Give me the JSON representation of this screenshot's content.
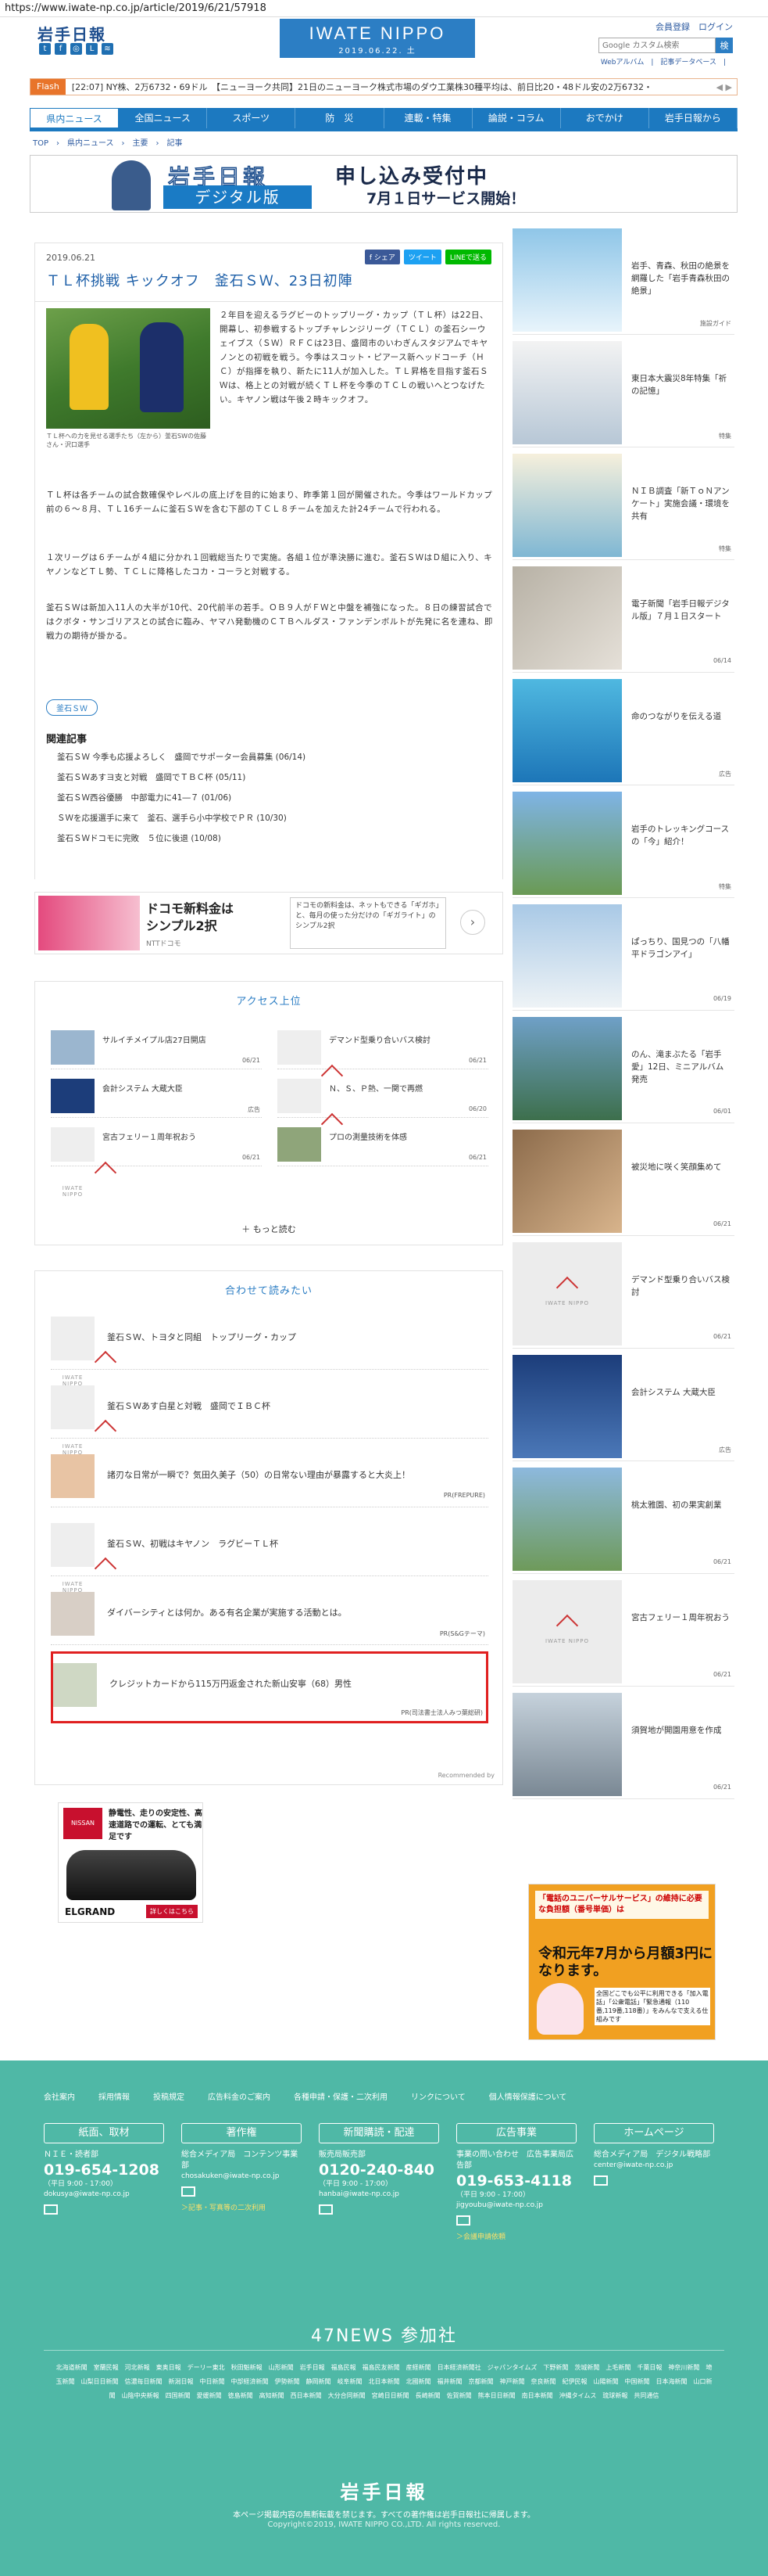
{
  "url": "https://www.iwate-np.co.jp/article/2019/6/21/57918",
  "header": {
    "logo": "岩手日報",
    "center_logo": "IWATE NIPPO",
    "center_date": "2019.06.22. 土",
    "member": "会員登録　ログイン",
    "search_placeholder": "Google カスタム検索",
    "search_button": "検",
    "toplinks": "Webアルバム　|　記事データベース　|　"
  },
  "flash": {
    "label": "Flash",
    "message": "[22:07] NY株、2万6732・69ドル　【ニューヨーク共同】21日のニューヨーク株式市場のダウ工業株30種平均は、前日比20・48ドル安の2万6732・",
    "arrows": "◀ ▶"
  },
  "nav": [
    "県内ニュース",
    "全国ニュース",
    "スポーツ",
    "防　災",
    "連載・特集",
    "論説・コラム",
    "おでかけ",
    "岩手日報から"
  ],
  "breadcrumb": "TOP　›　県内ニュース　›　主要　›　記事",
  "banner": {
    "logo": "岩手日報",
    "digital": "デジタル版",
    "title": "申し込み受付中",
    "subtitle": "7月１日サービス開始！"
  },
  "article": {
    "date": "2019.06.21",
    "share": [
      "f シェア",
      "ツイート",
      "LINEで送る"
    ],
    "title": "ＴＬ杯挑戦 キックオフ　釜石ＳＷ、23日初陣",
    "photo_caption": "ＴＬ杯への力を見せる選手たち（左から）釜石SWの佐藤さん・沢口選手",
    "p1": "２年目を迎えるラグビーのトップリーグ・カップ（ＴＬ杯）は22日、開幕し、初参戦するトップチャレンジリーグ（ＴＣＬ）の釜石シーウェイブス（ＳＷ）ＲＦＣは23日、盛岡市のいわぎんスタジアムでキヤノンとの初戦を戦う。今季はスコット・ピアース新ヘッドコーチ（ＨＣ）が指揮を執り、新たに11人が加入した。ＴＬ昇格を目指す釜石ＳＷは、格上との対戦が続くＴＬ杯を今季のＴＣＬの戦いへとつなげたい。キヤノン戦は午後２時キックオフ。",
    "p2": "ＴＬ杯は各チームの試合数確保やレベルの底上げを目的に始まり、昨季第１回が開催された。今季はワールドカップ前の６〜８月、ＴＬ16チームに釜石ＳＷを含む下部のＴＣＬ８チームを加えた計24チームで行われる。",
    "p3": "１次リーグは６チームが４組に分かれ１回戦総当たりで実施。各組１位が準決勝に進む。釜石ＳＷはＤ組に入り、キヤノンなどＴＬ勢、ＴＣＬに降格したコカ・コーラと対戦する。",
    "p4": "釜石ＳＷは新加入11人の大半が10代、20代前半の若手。ＯＢ９人がＦＷと中盤を補強になった。８日の練習試合ではクボタ・サンゴリアスとの試合に臨み、ヤマハ発動機のＣＴＢへルダス・ファンデンボルトが先発に名を連ね、即戦力の期待が掛かる。",
    "tag": "釜石ＳＷ",
    "related_title": "関連記事",
    "related": [
      "釜石ＳＷ 今季も応援よろしく　盛岡でサポーター会員募集 (06/14)",
      "釜石ＳＷあすヨ支と対戦　盛岡でＴＢＣ杯 (05/11)",
      "釜石ＳＷ西谷優勝　中部電力に41―７ (01/06)",
      "ＳＷを応援選手に来て　釜石、選手ら小中学校でＰＲ (10/30)",
      "釜石ＳＷドコモに完敗　５位に後退 (10/08)"
    ]
  },
  "ad_strip": {
    "title_1": "ドコモ新料金は",
    "title_2": "シンプル2択",
    "sponsor": "NTTドコモ",
    "box": "ドコモの新料金は、ネットもできる「ギガホ」と、毎月の使った分だけの「ギガライト」のシンプル2択",
    "go": "›"
  },
  "ranking": {
    "title": "アクセス上位",
    "items": [
      {
        "title": "サルイチメイプル店27日開店",
        "date": "06/21"
      },
      {
        "title": "デマンド型乗り合いバス検討",
        "date": "06/21"
      },
      {
        "title": "会計システム 大蔵大臣",
        "date": "広告"
      },
      {
        "title": "Ｎ、Ｓ、Ｐ熱、一関で再燃",
        "date": "06/20"
      },
      {
        "title": "宮古フェリー１周年祝おう",
        "date": "06/21"
      },
      {
        "title": "プロの測量技術を体感",
        "date": "06/21"
      }
    ],
    "more": "＋ もっと読む"
  },
  "recommend": {
    "title": "合わせて読みたい",
    "items": [
      {
        "title": "釜石ＳＷ、トヨタと同組　トップリーグ・カップ",
        "src": ""
      },
      {
        "title": "釜石ＳＷあす白星と対戦　盛岡でＩＢＣ杯",
        "src": ""
      },
      {
        "title": "諸刃な日常が一瞬で？気田久美子（50）の日常ない理由が暴露すると大炎上！",
        "src": "PR(FREPURE)"
      },
      {
        "title": "釜石ＳＷ、初戦はキヤノン　ラグビーＴＬ杯",
        "src": ""
      },
      {
        "title": "ダイバーシティとは何か。ある有名企業が実施する活動とは。",
        "src": "PR(S&Gテーマ)"
      },
      {
        "title": "クレジットカードから115万円返金された新山安寧（68）男性",
        "src": "PR(司法書士法人みつ葉総研)"
      }
    ],
    "by": "Recommended by"
  },
  "car_ad": {
    "brand": "NISSAN",
    "text": "静電性、走りの安定性、高速道路での運転、とても満足です",
    "name": "ELGRAND",
    "button": "詳しくはこちら"
  },
  "sidebar": {
    "items": [
      {
        "title": "岩手、青森、秋田の絶景を網羅した「岩手青森秋田の絶景」",
        "meta": "施設ガイド"
      },
      {
        "title": "東日本大震災8年特集「祈の記憶」",
        "meta": "特集"
      },
      {
        "title": "ＮＩＢ調査「新ＴｏＮアンケート」実施会議・環境を共有",
        "meta": "特集"
      },
      {
        "title": "電子新聞「岩手日報デジタル版」７月１日スタート",
        "meta": "06/14"
      },
      {
        "title": "命のつながりを伝える道",
        "meta": "広告"
      },
      {
        "title": "岩手のトレッキングコースの「今」紹介！",
        "meta": "特集"
      },
      {
        "title": "ぱっちり、国見つの「八幡平ドラゴンアイ」",
        "meta": "06/19"
      },
      {
        "title": "のん、滝まぶたる「岩手愛」12日、ミニアルバム発売",
        "meta": "06/01"
      },
      {
        "title": "被災地に咲く笑顔集めて",
        "meta": "06/21"
      },
      {
        "title": "デマンド型乗り合いバス検討",
        "meta": "06/21"
      },
      {
        "title": "会計システム 大蔵大臣",
        "meta": "広告"
      },
      {
        "title": "桃太雅園、初の果実創業",
        "meta": "06/21"
      },
      {
        "title": "宮古フェリー１周年祝おう",
        "meta": "06/21"
      },
      {
        "title": "須賀地が開園用意を作成",
        "meta": "06/21"
      }
    ]
  },
  "side_ad": {
    "t1": "「電話のユニバーサルサービス」の維持に必要な負担額（番号単価）は",
    "t2": "令和元年7月から月額3円になります。",
    "t3": "全国どこでも公平に利用できる「加入電話」「公衆電話」「緊急通報（110番,119番,118番）」をみんなで支える仕組みです"
  },
  "footer": {
    "links": [
      "会社案内",
      "採用情報",
      "投稿規定",
      "広告料金のご案内",
      "各種申請・保護・二次利用",
      "リンクについて",
      "個人情報保護について"
    ],
    "cols": [
      {
        "head": "紙面、取材",
        "l1": "ＮＩＥ・読者部",
        "phone": "019-654-1208",
        "hours": "（平日 9:00 - 17:00）",
        "mail": "dokusya@iwate-np.co.jp",
        "link": ""
      },
      {
        "head": "著作権",
        "l1": "総合メディア局　コンテンツ事業部",
        "phone": "",
        "hours": "",
        "mail": "chosakuken@iwate-np.co.jp",
        "link": "＞記事・写真等の二次利用"
      },
      {
        "head": "新聞購読・配達",
        "l1": "販売局販売部",
        "phone": "0120-240-840",
        "hours": "（平日 9:00 - 17:00）",
        "mail": "hanbai@iwate-np.co.jp",
        "link": ""
      },
      {
        "head": "広告事業",
        "l1": "事業の問い合わせ　広告事業局広告部",
        "phone": "019-653-4118",
        "hours": "（平日 9:00 - 17:00）",
        "mail": "jigyoubu@iwate-np.co.jp",
        "link": "＞会議申請依頼"
      },
      {
        "head": "ホームページ",
        "l1": "総合メディア局　デジタル戦略部",
        "phone": "",
        "hours": "",
        "mail": "center@iwate-np.co.jp",
        "link": ""
      }
    ],
    "n47": "47NEWS 参加社",
    "papers": "北海道新聞　室蘭民報　河北新報　東奥日報　デーリー東北　秋田魁新報　山形新聞　岩手日報　福島民報　福島民友新聞　産経新聞　日本経済新聞社　ジャパンタイムズ　下野新聞　茨城新聞　上毛新聞　千葉日報　神奈川新聞　埼玉新聞　山梨日日新聞　信濃毎日新聞　新潟日報　中日新聞　中部経済新聞　伊勢新聞　静岡新聞　岐阜新聞　北日本新聞　北國新聞　福井新聞　京都新聞　神戸新聞　奈良新聞　紀伊民報　山陽新聞　中国新聞　日本海新聞　山口新聞　山陰中央新報　四国新聞　愛媛新聞　徳島新聞　高知新聞　西日本新聞　大分合同新聞　宮崎日日新聞　長崎新聞　佐賀新聞　熊本日日新聞　南日本新聞　沖縄タイムス　琉球新報　共同通信",
    "logo": "岩手日報",
    "copy1": "本ページ掲載内容の無断転載を禁じます。すべての著作権は岩手日報社に帰属します。",
    "copy2": "Copyright©2019, IWATE NIPPO CO.,LTD. All rights reserved."
  }
}
